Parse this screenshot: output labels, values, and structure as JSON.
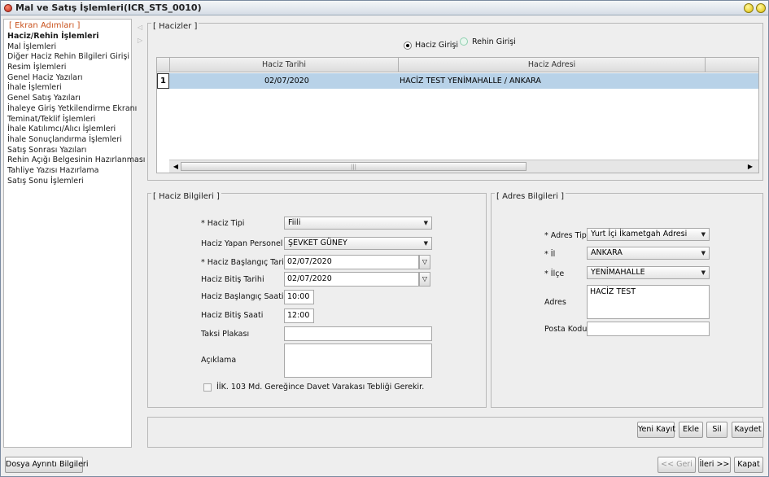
{
  "window": {
    "title": "Mal ve Satış İşlemleri(ICR_STS_0010)"
  },
  "steps": {
    "title": "[ Ekran Adımları ]",
    "items": [
      {
        "label": "Haciz/Rehin İşlemleri",
        "active": true
      },
      {
        "label": "Mal İşlemleri"
      },
      {
        "label": "Diğer Haciz Rehin Bilgileri Girişi"
      },
      {
        "label": "Resim İşlemleri"
      },
      {
        "label": "Genel Haciz Yazıları"
      },
      {
        "label": "İhale İşlemleri"
      },
      {
        "label": "Genel Satış Yazıları"
      },
      {
        "label": "İhaleye Giriş Yetkilendirme Ekranı"
      },
      {
        "label": "Teminat/Teklif İşlemleri"
      },
      {
        "label": "İhale Katılımcı/Alıcı İşlemleri"
      },
      {
        "label": "İhale Sonuçlandırma İşlemleri"
      },
      {
        "label": "Satış Sonrası Yazıları"
      },
      {
        "label": "Rehin Açığı Belgesinin Hazırlanması"
      },
      {
        "label": "Tahliye Yazısı Hazırlama"
      },
      {
        "label": "Satış Sonu İşlemleri"
      }
    ]
  },
  "hacizler": {
    "legend": "[ Hacizler ]",
    "radio_haciz": "Haciz Girişi",
    "radio_rehin": "Rehin Girişi",
    "columns": [
      "Haciz Tarihi",
      "Haciz Adresi"
    ],
    "rows": [
      {
        "num": "1",
        "tarih": "02/07/2020",
        "adres": "HACİZ TEST  YENİMAHALLE / ANKARA"
      }
    ]
  },
  "haciz_bilgileri": {
    "legend": "[ Haciz Bilgileri ]",
    "haciz_tipi_label": "* Haciz Tipi",
    "haciz_tipi_value": "Fiili",
    "personel_label": "Haciz Yapan Personel",
    "personel_value": "ŞEVKET  GÜNEY",
    "baslangic_tarihi_label": "* Haciz Başlangıç Tarihi",
    "baslangic_tarihi_value": "02/07/2020",
    "bitis_tarihi_label": "Haciz Bitiş Tarihi",
    "bitis_tarihi_value": "02/07/2020",
    "baslangic_saati_label": "Haciz Başlangıç Saati",
    "baslangic_saati_value": "10:00",
    "bitis_saati_label": "Haciz Bitiş Saati",
    "bitis_saati_value": "12:00",
    "taksi_label": "Taksi Plakası",
    "taksi_value": "",
    "aciklama_label": "Açıklama",
    "aciklama_value": "",
    "checkbox_label": "İİK. 103 Md. Gereğince Davet Varakası Tebliği Gerekir."
  },
  "adres_bilgileri": {
    "legend": "[ Adres Bilgileri ]",
    "adres_tipi_label": "* Adres Tipi",
    "adres_tipi_value": "Yurt İçi İkametgah Adresi",
    "il_label": "* İl",
    "il_value": "ANKARA",
    "ilce_label": "* İlçe",
    "ilce_value": "YENİMAHALLE",
    "adres_label": "Adres",
    "adres_value": "HACİZ TEST",
    "posta_kodu_label": "Posta Kodu",
    "posta_kodu_value": ""
  },
  "actions": {
    "yeni_kayit": "Yeni Kayıt",
    "ekle": "Ekle",
    "sil": "Sil",
    "kaydet": "Kaydet"
  },
  "footer": {
    "dosya": "Dosya Ayrıntı Bilgileri",
    "geri": "<< Geri",
    "ileri": "İleri >>",
    "kapat": "Kapat"
  }
}
